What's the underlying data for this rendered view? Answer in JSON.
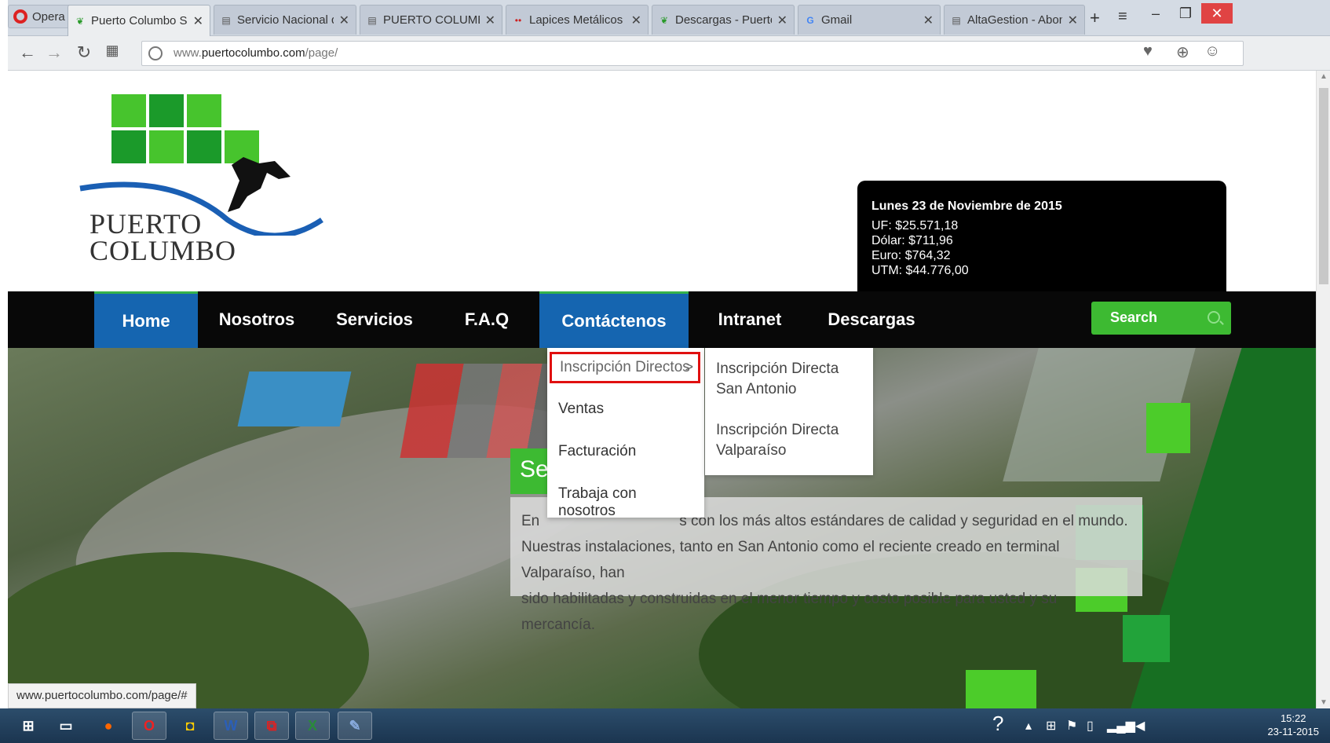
{
  "browser": {
    "opera_label": "Opera",
    "tabs": [
      {
        "label": "Puerto Columbo S.A",
        "icon": "leaf-favicon"
      },
      {
        "label": "Servicio Nacional de",
        "icon": "document-favicon"
      },
      {
        "label": "PUERTO COLUMBO",
        "icon": "document-favicon"
      },
      {
        "label": "Lapices Metálicos | I",
        "icon": "dots-favicon"
      },
      {
        "label": "Descargas - Puerto",
        "icon": "leaf-favicon"
      },
      {
        "label": "Gmail",
        "icon": "google-favicon"
      },
      {
        "label": "AltaGestion - Abon",
        "icon": "document-favicon"
      }
    ],
    "url_host": "www.puertocolumbo.com",
    "url_prefix": "www.",
    "url_domain": "puertocolumbo.com",
    "url_path": "/page/"
  },
  "logo": {
    "line1": "PUERTO",
    "line2": "COLUMBO"
  },
  "ticker": {
    "date": "Lunes 23 de Noviembre de 2015",
    "uf": "UF: $25.571,18",
    "dolar": "Dólar: $711,96",
    "euro": "Euro: $764,32",
    "utm": "UTM: $44.776,00"
  },
  "menu": {
    "home": "Home",
    "nosotros": "Nosotros",
    "servicios": "Servicios",
    "faq": "F.A.Q",
    "contactenos": "Contáctenos",
    "intranet": "Intranet",
    "descargas": "Descargas",
    "search_placeholder": "Search"
  },
  "dropdown": {
    "items": [
      "Inscripción Directos",
      "Ventas",
      "Facturación",
      "Trabaja con nosotros"
    ],
    "arrow": ">"
  },
  "submenu": {
    "item1_line1": "Inscripción Directa",
    "item1_line2": "San Antonio",
    "item2_line1": "Inscripción Directa",
    "item2_line2": "Valparaíso"
  },
  "hero": {
    "caption_title_partial": "Se",
    "caption_line1_start": "En",
    "caption_line1_rest": "s con los más altos estándares de calidad y seguridad en el mundo.",
    "caption_line2": "Nuestras instalaciones, tanto en San Antonio como el reciente creado en terminal Valparaíso, han",
    "caption_line3": "sido habilitadas y construidas en el menor tiempo y costo posible para usted y su mercancía."
  },
  "status_bar": "www.puertocolumbo.com/page/#",
  "taskbar": {
    "time": "15:22",
    "date": "23-11-2015"
  },
  "colors": {
    "brand_green": "#3dba32",
    "menu_blue": "#1565b0",
    "highlight_red": "#e01010"
  }
}
